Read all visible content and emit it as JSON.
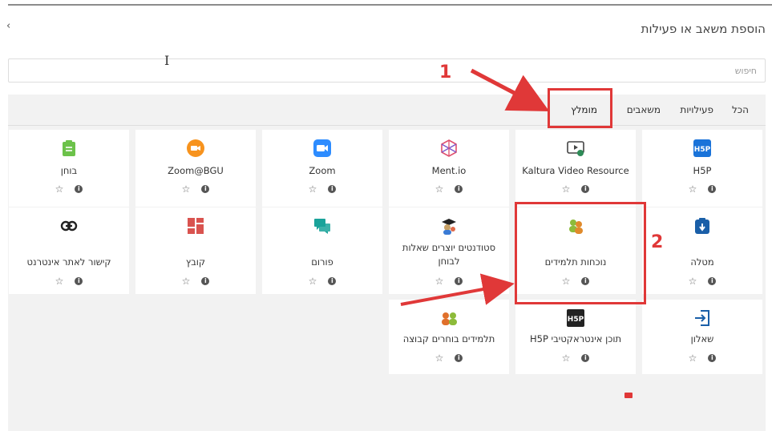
{
  "modal": {
    "title": "הוספת משאב או פעילות",
    "close_glyph": "‹",
    "search_placeholder": "חיפוש",
    "cursor_glyph": "I"
  },
  "tabs": [
    {
      "label": "הכל"
    },
    {
      "label": "פעילויות"
    },
    {
      "label": "משאבים"
    },
    {
      "label": "מומלץ",
      "active": true
    }
  ],
  "cards": [
    {
      "name": "H5P",
      "icon": "h5p-icon"
    },
    {
      "name": "Kaltura Video Resource",
      "icon": "kaltura-video-icon"
    },
    {
      "name": "Ment.io",
      "icon": "mentio-icon"
    },
    {
      "name": "Zoom",
      "icon": "zoom-icon"
    },
    {
      "name": "Zoom@BGU",
      "icon": "zoom-bgu-icon"
    },
    {
      "name": "בוחן",
      "icon": "quiz-icon"
    },
    {
      "name": "מטלה",
      "icon": "assignment-icon"
    },
    {
      "name": "נוכחות תלמידים",
      "icon": "attendance-icon"
    },
    {
      "name": "סטודנטים יוצרים שאלות לבוחן",
      "icon": "student-quiz-icon"
    },
    {
      "name": "פורום",
      "icon": "forum-icon"
    },
    {
      "name": "קובץ",
      "icon": "file-icon"
    },
    {
      "name": "קישור לאתר אינטרנט",
      "icon": "url-link-icon"
    },
    {
      "name": "שאלון",
      "icon": "feedback-icon"
    },
    {
      "name": "תוכן אינטראקטיבי H5P",
      "icon": "h5p-interactive-icon"
    },
    {
      "name": "תלמידים בוחרים קבוצה",
      "icon": "group-choice-icon"
    }
  ],
  "annotations": {
    "step1": "1",
    "step2": "2"
  },
  "meta": {
    "info_glyph": "i",
    "star_glyph": "☆"
  },
  "colors": {
    "annotation_red": "#e03838",
    "zoom_blue": "#2d8cff",
    "zoom_bgu_orange": "#f7931e",
    "quiz_green": "#6cc24a",
    "h5p_blue": "#1a73d9",
    "forum_teal": "#1aa39a",
    "file_red": "#d9534f"
  }
}
